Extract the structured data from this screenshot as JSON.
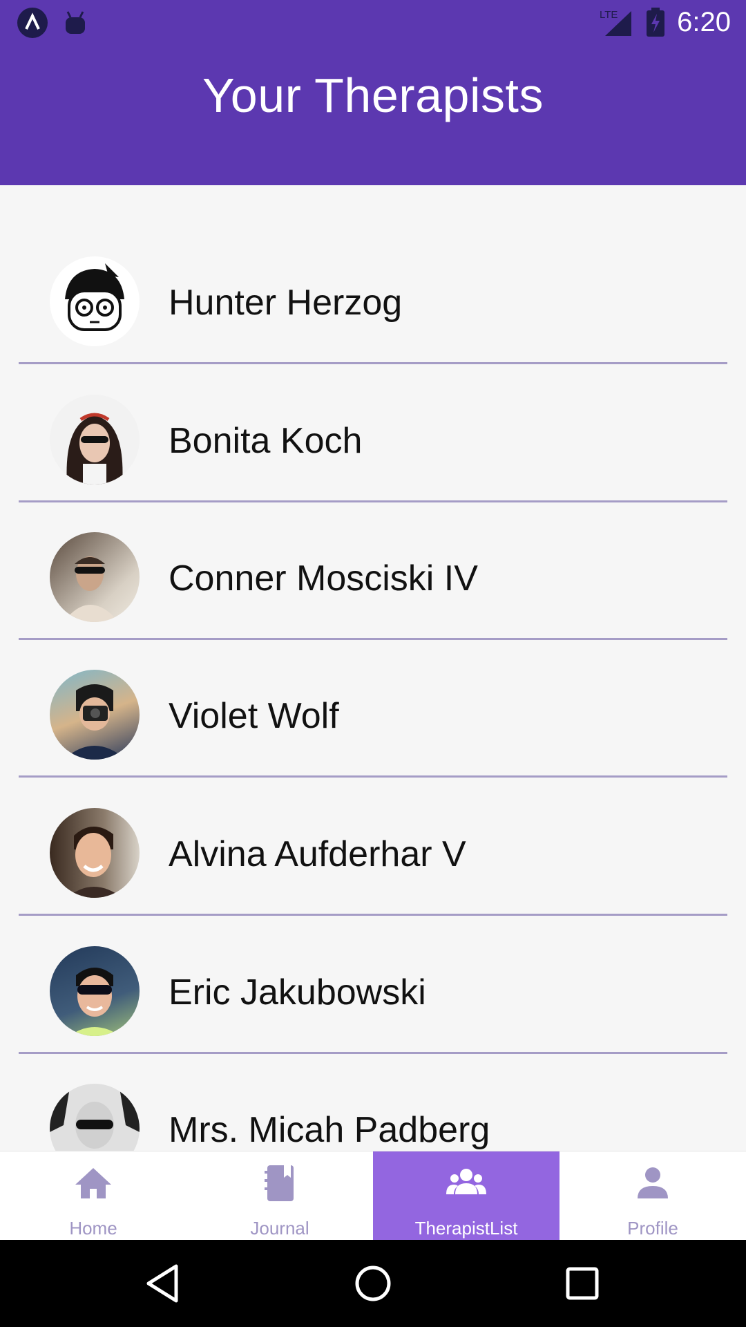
{
  "status_bar": {
    "time": "6:20",
    "icons": [
      "app-logo-icon",
      "robot-icon",
      "lte-signal-icon",
      "battery-charging-icon"
    ],
    "network_label": "LTE"
  },
  "header": {
    "title": "Your Therapists"
  },
  "therapists": [
    {
      "name": "Hunter Herzog"
    },
    {
      "name": "Bonita Koch"
    },
    {
      "name": "Conner Mosciski IV"
    },
    {
      "name": "Violet Wolf"
    },
    {
      "name": "Alvina Aufderhar V"
    },
    {
      "name": "Eric Jakubowski"
    },
    {
      "name": "Mrs. Micah Padberg"
    }
  ],
  "tabs": [
    {
      "label": "Home",
      "icon": "home-icon",
      "active": false
    },
    {
      "label": "Journal",
      "icon": "journal-icon",
      "active": false
    },
    {
      "label": "TherapistList",
      "icon": "group-icon",
      "active": true
    },
    {
      "label": "Profile",
      "icon": "person-icon",
      "active": false
    }
  ],
  "colors": {
    "header_bg": "#5c38b0",
    "active_tab_bg": "#9366e0",
    "inactive_tab": "#9f95c4",
    "divider": "#a59cc6"
  }
}
